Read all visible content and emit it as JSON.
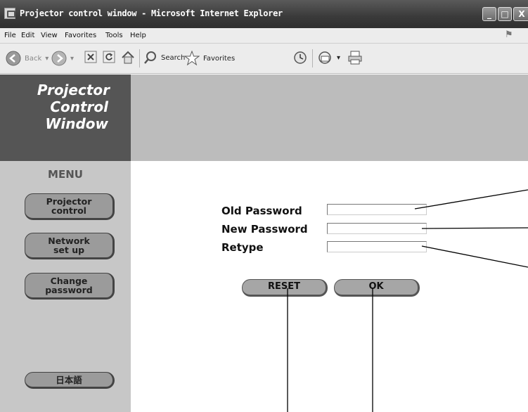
{
  "window": {
    "title": "Projector control window - Microsoft Internet Explorer",
    "minimize": "_",
    "maximize": "□",
    "close": "X"
  },
  "menubar": [
    "File",
    "Edit",
    "View",
    "Favorites",
    "Tools",
    "Help"
  ],
  "toolbar": {
    "back": "Back",
    "search": "Search",
    "favorites": "Favorites"
  },
  "logo": {
    "line1": "Projector",
    "line2": "Control",
    "line3": "Window"
  },
  "sidebar": {
    "menu_title": "MENU",
    "items": [
      {
        "label": "Projector\ncontrol"
      },
      {
        "label": "Network\nset up"
      },
      {
        "label": "Change\npassword"
      },
      {
        "label": "日本語"
      }
    ]
  },
  "form": {
    "old_password_label": "Old Password",
    "new_password_label": "New Password",
    "retype_label": "Retype",
    "old_password_value": "",
    "new_password_value": "",
    "retype_value": "",
    "reset_label": "RESET",
    "ok_label": "OK"
  }
}
